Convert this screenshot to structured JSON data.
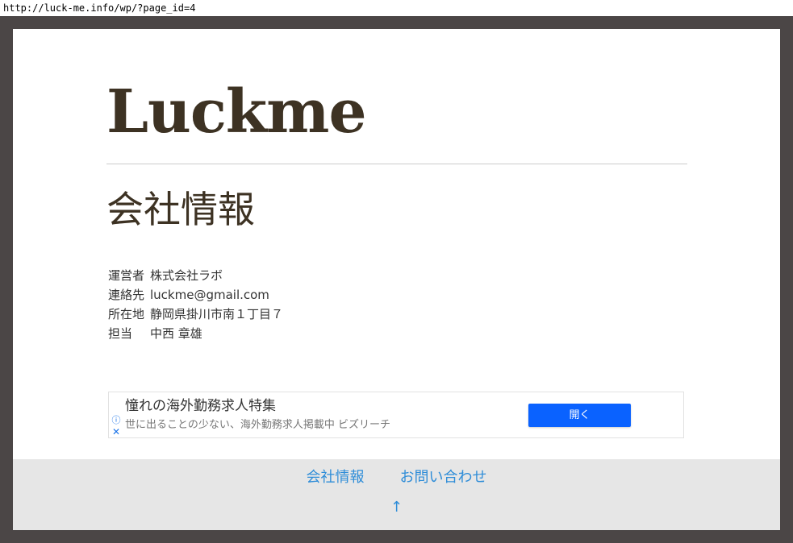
{
  "browser": {
    "url": "http://luck-me.info/wp/?page_id=4"
  },
  "site": {
    "title": "Luckme"
  },
  "page": {
    "heading": "会社情報",
    "info": [
      {
        "label": "運営者",
        "value": "株式会社ラボ"
      },
      {
        "label": "連絡先",
        "value": "luckme@gmail.com"
      },
      {
        "label": "所在地",
        "value": "静岡県掛川市南１丁目７"
      },
      {
        "label": "担当",
        "value": "中西 章雄"
      }
    ]
  },
  "ad": {
    "title": "憧れの海外勤務求人特集",
    "description": "世に出ることの少ない、海外勤務求人掲載中 ビズリーチ",
    "button_label": "開く",
    "info_icon": "ⓘ",
    "close_icon": "✕"
  },
  "footer": {
    "links": [
      {
        "label": "会社情報"
      },
      {
        "label": "お問い合わせ"
      }
    ],
    "back_to_top": "↑"
  },
  "colors": {
    "frame": "#4b4646",
    "title": "#3d3223",
    "link": "#2f8dd8",
    "ad_button": "#0a62ff",
    "footer_bg": "#e6e6e6"
  }
}
